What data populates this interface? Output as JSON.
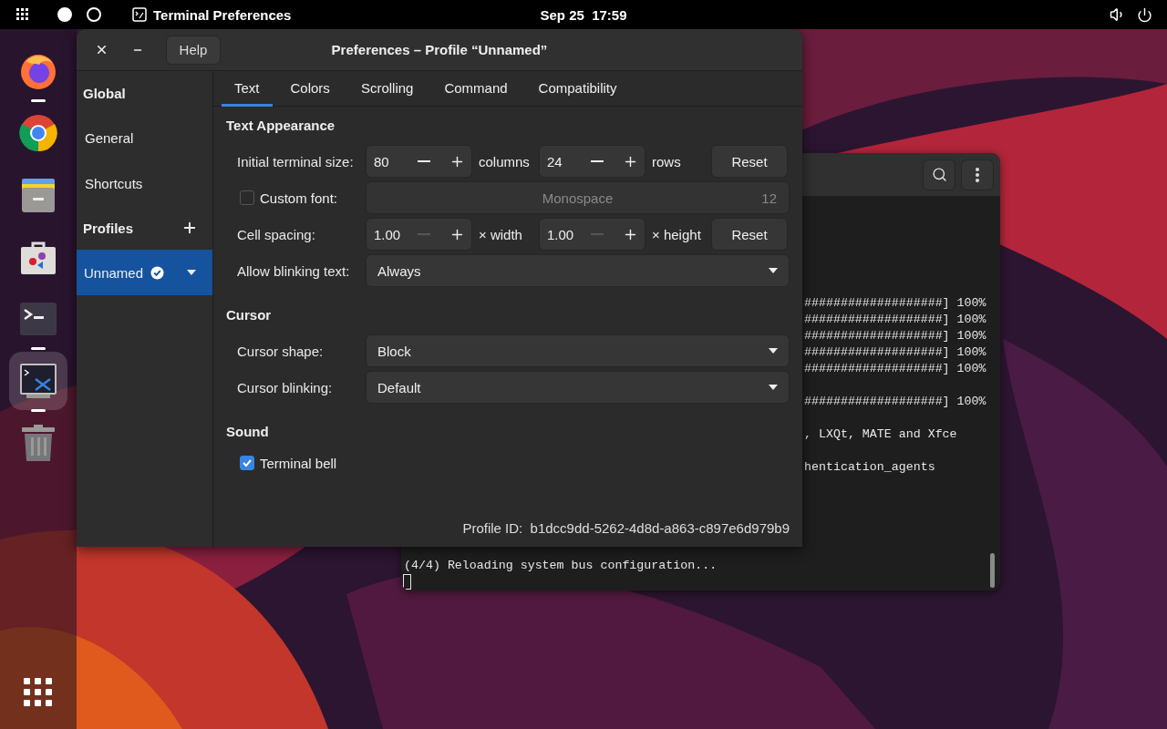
{
  "top_bar": {
    "workspaces": [
      {
        "selected": true
      },
      {
        "selected": false
      }
    ],
    "app_menu": "Terminal Preferences",
    "clock": "Sep 25  17:59"
  },
  "dock": {
    "items": [
      {
        "kind": "firefox",
        "running": true,
        "selected": false
      },
      {
        "kind": "chrome",
        "running": false,
        "selected": false
      },
      {
        "kind": "files",
        "running": false,
        "selected": false
      },
      {
        "kind": "store",
        "running": false,
        "selected": false
      },
      {
        "kind": "terminal",
        "running": true,
        "selected": false
      },
      {
        "kind": "prefs",
        "running": true,
        "selected": true
      },
      {
        "kind": "trash",
        "running": false,
        "selected": false
      }
    ]
  },
  "terminal": {
    "lines": [
      {
        "kind": "partial",
        "text": "###################] 100%"
      },
      {
        "kind": "partial",
        "text": "###################] 100%"
      },
      {
        "kind": "partial",
        "text": "###################] 100%"
      },
      {
        "kind": "partial",
        "text": "###################] 100%"
      },
      {
        "kind": "partial",
        "text": "###################] 100%"
      },
      {
        "kind": "blank"
      },
      {
        "kind": "partial",
        "text": "###################] 100%"
      },
      {
        "kind": "blank"
      },
      {
        "kind": "partial",
        "text": ", LXQt, MATE and Xfce"
      },
      {
        "kind": "blank"
      },
      {
        "kind": "partial",
        "text": "hentication_agents"
      },
      {
        "kind": "blank"
      },
      {
        "kind": "blank"
      },
      {
        "kind": "blank"
      },
      {
        "kind": "blank"
      },
      {
        "kind": "blank"
      },
      {
        "kind": "full",
        "text": "(4/4) Reloading system bus configuration..."
      },
      {
        "kind": "cursor"
      }
    ]
  },
  "preferences": {
    "title": "Preferences – Profile “Unnamed”",
    "help": "Help",
    "sidebar": {
      "global": {
        "heading": "Global",
        "items": [
          {
            "label": "General",
            "selected": false
          },
          {
            "label": "Shortcuts",
            "selected": false
          }
        ]
      },
      "profiles": {
        "heading": "Profiles",
        "items": [
          {
            "label": "Unnamed",
            "selected": true,
            "default": true
          }
        ]
      }
    },
    "tabs": [
      {
        "label": "Text",
        "selected": true
      },
      {
        "label": "Colors",
        "selected": false
      },
      {
        "label": "Scrolling",
        "selected": false
      },
      {
        "label": "Command",
        "selected": false
      },
      {
        "label": "Compatibility",
        "selected": false
      }
    ],
    "sections": [
      {
        "heading": "Text Appearance",
        "rows": [
          {
            "kind": "size",
            "label": "Initial terminal size:",
            "spinners": [
              {
                "value": "80",
                "unit": "columns",
                "minus_disabled": false
              },
              {
                "value": "24",
                "unit": "rows",
                "minus_disabled": false
              }
            ],
            "reset": "Reset"
          },
          {
            "kind": "font",
            "label": "Custom font:",
            "checked": false,
            "font": "Monospace",
            "size": "12",
            "disabled": true
          },
          {
            "kind": "size",
            "label": "Cell spacing:",
            "spinners": [
              {
                "value": "1.00",
                "unit": "× width",
                "minus_disabled": true
              },
              {
                "value": "1.00",
                "unit": "× height",
                "minus_disabled": true
              }
            ],
            "reset": "Reset"
          },
          {
            "kind": "dropdown",
            "label": "Allow blinking text:",
            "value": "Always"
          }
        ]
      },
      {
        "heading": "Cursor",
        "rows": [
          {
            "kind": "dropdown",
            "label": "Cursor shape:",
            "value": "Block"
          },
          {
            "kind": "dropdown",
            "label": "Cursor blinking:",
            "value": "Default"
          }
        ]
      },
      {
        "heading": "Sound",
        "rows": [
          {
            "kind": "check",
            "label": "Terminal bell",
            "checked": true
          }
        ]
      }
    ],
    "profile_id": {
      "label": "Profile ID:",
      "value": "b1dcc9dd-5262-4d8d-a863-c897e6d979b9"
    }
  }
}
